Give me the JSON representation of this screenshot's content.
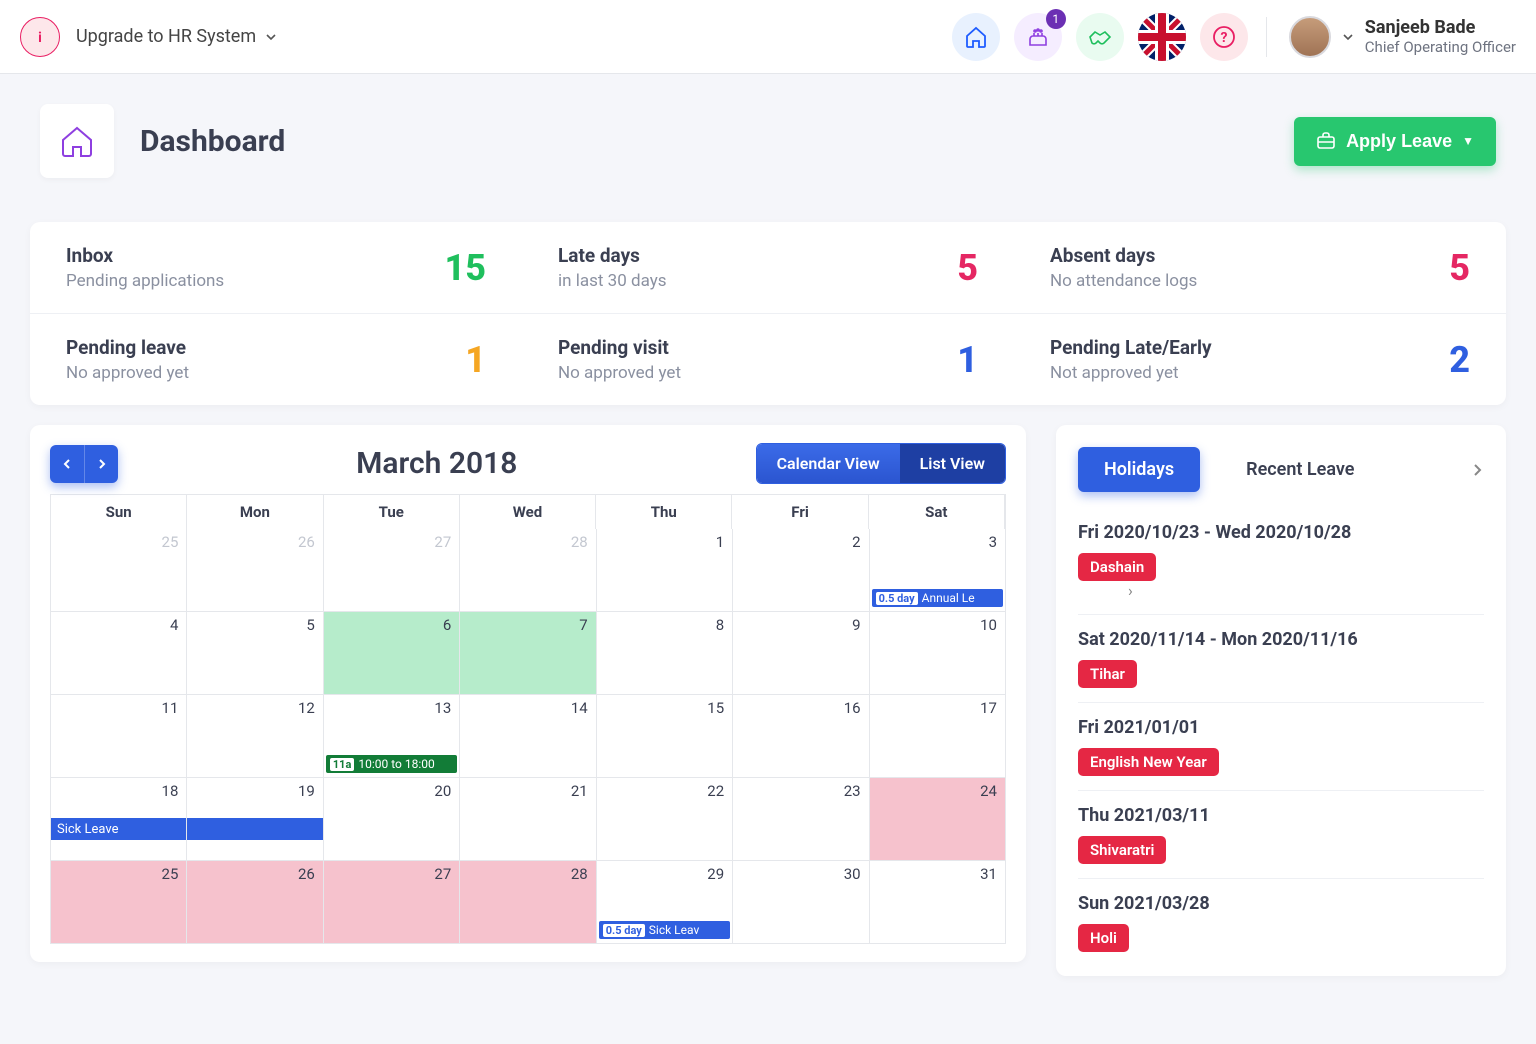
{
  "topbar": {
    "upgrade_label": "Upgrade to HR System",
    "badge_cake": "1",
    "user_name": "Sanjeeb Bade",
    "user_role": "Chief Operating Officer"
  },
  "header": {
    "title": "Dashboard",
    "apply_label": "Apply Leave"
  },
  "stats": [
    {
      "title": "Inbox",
      "sub": "Pending applications",
      "value": "15",
      "color": "num-green"
    },
    {
      "title": "Late days",
      "sub": "in last 30 days",
      "value": "5",
      "color": "num-pink"
    },
    {
      "title": "Absent days",
      "sub": "No attendance logs",
      "value": "5",
      "color": "num-pink"
    },
    {
      "title": "Pending leave",
      "sub": "No approved yet",
      "value": "1",
      "color": "num-orange"
    },
    {
      "title": "Pending visit",
      "sub": "No approved yet",
      "value": "1",
      "color": "num-blue"
    },
    {
      "title": "Pending Late/Early",
      "sub": "Not approved yet",
      "value": "2",
      "color": "num-blue"
    }
  ],
  "calendar": {
    "title": "March 2018",
    "view_calendar": "Calendar View",
    "view_list": "List View",
    "dow": [
      "Sun",
      "Mon",
      "Tue",
      "Wed",
      "Thu",
      "Fri",
      "Sat"
    ],
    "weeks": [
      [
        {
          "n": "25",
          "dim": true
        },
        {
          "n": "26",
          "dim": true
        },
        {
          "n": "27",
          "dim": true
        },
        {
          "n": "28",
          "dim": true
        },
        {
          "n": "1"
        },
        {
          "n": "2"
        },
        {
          "n": "3",
          "ev": {
            "cls": "ev-blue",
            "pill": "0.5 day",
            "text": "Annual Le"
          }
        }
      ],
      [
        {
          "n": "4"
        },
        {
          "n": "5"
        },
        {
          "n": "6",
          "bg": "bg-green"
        },
        {
          "n": "7",
          "bg": "bg-green"
        },
        {
          "n": "8"
        },
        {
          "n": "9"
        },
        {
          "n": "10"
        }
      ],
      [
        {
          "n": "11"
        },
        {
          "n": "12"
        },
        {
          "n": "13",
          "ev": {
            "cls": "ev-green",
            "pill": "11a",
            "text": "10:00 to 18:00"
          }
        },
        {
          "n": "14"
        },
        {
          "n": "15"
        },
        {
          "n": "16"
        },
        {
          "n": "17"
        }
      ],
      [
        {
          "n": "18",
          "span": {
            "text": "Sick Leave"
          }
        },
        {
          "n": "19",
          "spanCont": true
        },
        {
          "n": "20"
        },
        {
          "n": "21"
        },
        {
          "n": "22"
        },
        {
          "n": "23"
        },
        {
          "n": "24",
          "bg": "bg-pink"
        }
      ],
      [
        {
          "n": "25",
          "bg": "bg-pink"
        },
        {
          "n": "26",
          "bg": "bg-pink"
        },
        {
          "n": "27",
          "bg": "bg-pink"
        },
        {
          "n": "28",
          "bg": "bg-pink"
        },
        {
          "n": "29",
          "ev": {
            "cls": "ev-blue",
            "pill": "0.5 day",
            "text": "Sick Leav"
          }
        },
        {
          "n": "30"
        },
        {
          "n": "31"
        }
      ]
    ]
  },
  "side": {
    "tab_holidays": "Holidays",
    "tab_recent": "Recent Leave",
    "items": [
      {
        "date": "Fri 2020/10/23 - Wed 2020/10/28",
        "tag": "Dashain",
        "ptr": true
      },
      {
        "date": "Sat 2020/11/14 - Mon 2020/11/16",
        "tag": "Tihar"
      },
      {
        "date": "Fri 2021/01/01",
        "tag": "English New Year"
      },
      {
        "date": "Thu 2021/03/11",
        "tag": "Shivaratri"
      },
      {
        "date": "Sun 2021/03/28",
        "tag": "Holi"
      }
    ]
  }
}
